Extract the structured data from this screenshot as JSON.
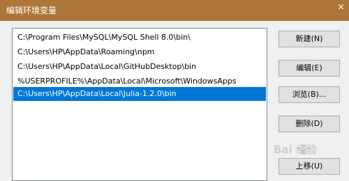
{
  "window": {
    "title": "编辑环境变量"
  },
  "paths": [
    "C:\\Program Files\\MySQL\\MySQL Shell 8.0\\bin\\",
    "C:\\Users\\HP\\AppData\\Roaming\\npm",
    "C:\\Users\\HP\\AppData\\Local\\GitHubDesktop\\bin",
    "%USERPROFILE%\\AppData\\Local\\Microsoft\\WindowsApps",
    "C:\\Users\\HP\\AppData\\Local\\Julia-1.2.0\\bin"
  ],
  "buttons": {
    "new": "新建(N)",
    "edit": "编辑(E)",
    "browse": "浏览(B)...",
    "delete": "删除(D)",
    "move_up": "上移(U)"
  },
  "watermark": {
    "text": "Bai 经验"
  },
  "colors": {
    "titlebar": "#ae7639",
    "selection": "#0078d7"
  }
}
